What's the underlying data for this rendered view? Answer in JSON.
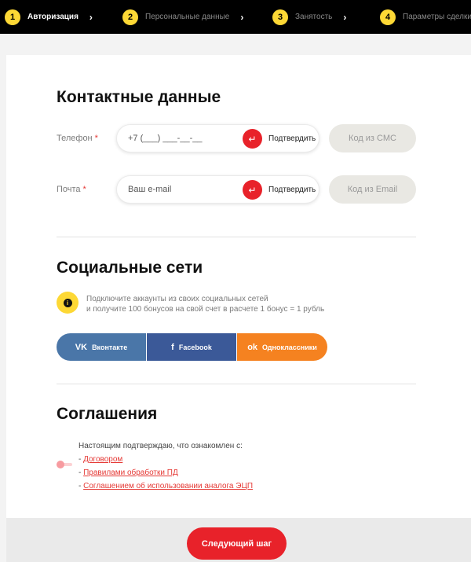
{
  "steps": [
    {
      "num": "1",
      "label": "Авторизация",
      "active": true
    },
    {
      "num": "2",
      "label": "Персональные данные",
      "active": false
    },
    {
      "num": "3",
      "label": "Занятость",
      "active": false
    },
    {
      "num": "4",
      "label": "Параметры сделки",
      "active": false
    }
  ],
  "step_chevron": "›",
  "contacts": {
    "title": "Контактные данные",
    "required_mark": "*",
    "phone": {
      "label": "Телефон",
      "placeholder": "+7 (___) ___-__-__",
      "confirm_label": "Подтвердить",
      "code_placeholder": "Код из СМС"
    },
    "email": {
      "label": "Почта",
      "placeholder": "Ваш e-mail",
      "confirm_label": "Подтвердить",
      "code_placeholder": "Код из Email"
    },
    "enter_glyph": "↵"
  },
  "social": {
    "title": "Социальные сети",
    "info_glyph": "i",
    "note_line1": "Подключите аккаунты из своих социальных сетей",
    "note_line2": "и получите 100 бонусов на свой счет в расчете 1 бонус = 1 рубль",
    "buttons": {
      "vk": {
        "icon": "vk-icon",
        "glyph": "VK",
        "label": "Вконтакте",
        "color": "#4a76a8"
      },
      "facebook": {
        "icon": "facebook-icon",
        "glyph": "f",
        "label": "Facebook",
        "color": "#3b5998"
      },
      "ok": {
        "icon": "odnoklassniki-icon",
        "glyph": "ok",
        "label": "Одноклассники",
        "color": "#f58220"
      }
    }
  },
  "agreements": {
    "title": "Соглашения",
    "intro": "Настоящим подтверждаю, что ознакомлен с:",
    "prefix": "- ",
    "links": [
      "Договором",
      "Правилами обработки ПД",
      "Соглашением об использовании аналога ЭЦП"
    ],
    "accepted": false
  },
  "footer": {
    "next_label": "Следующий шаг"
  },
  "colors": {
    "accent": "#e8222a",
    "step_badge": "#fdd835",
    "header_bg": "#000000"
  }
}
